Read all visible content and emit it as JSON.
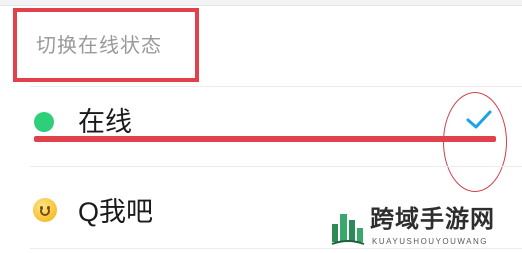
{
  "section": {
    "header": "切换在线状态"
  },
  "statuses": [
    {
      "label": "在线",
      "icon": "green-dot-icon",
      "dot_color": "#2fcf7a",
      "selected": true
    },
    {
      "label": "Q我吧",
      "icon": "smiley-emoji-icon",
      "selected": false
    }
  ],
  "annotations": {
    "highlight_color": "#e0414b"
  },
  "accent_color": "#1aa3e8",
  "watermark": {
    "title": "跨域手游网",
    "subtitle": "KUAYUSHOUYOUWANG"
  }
}
